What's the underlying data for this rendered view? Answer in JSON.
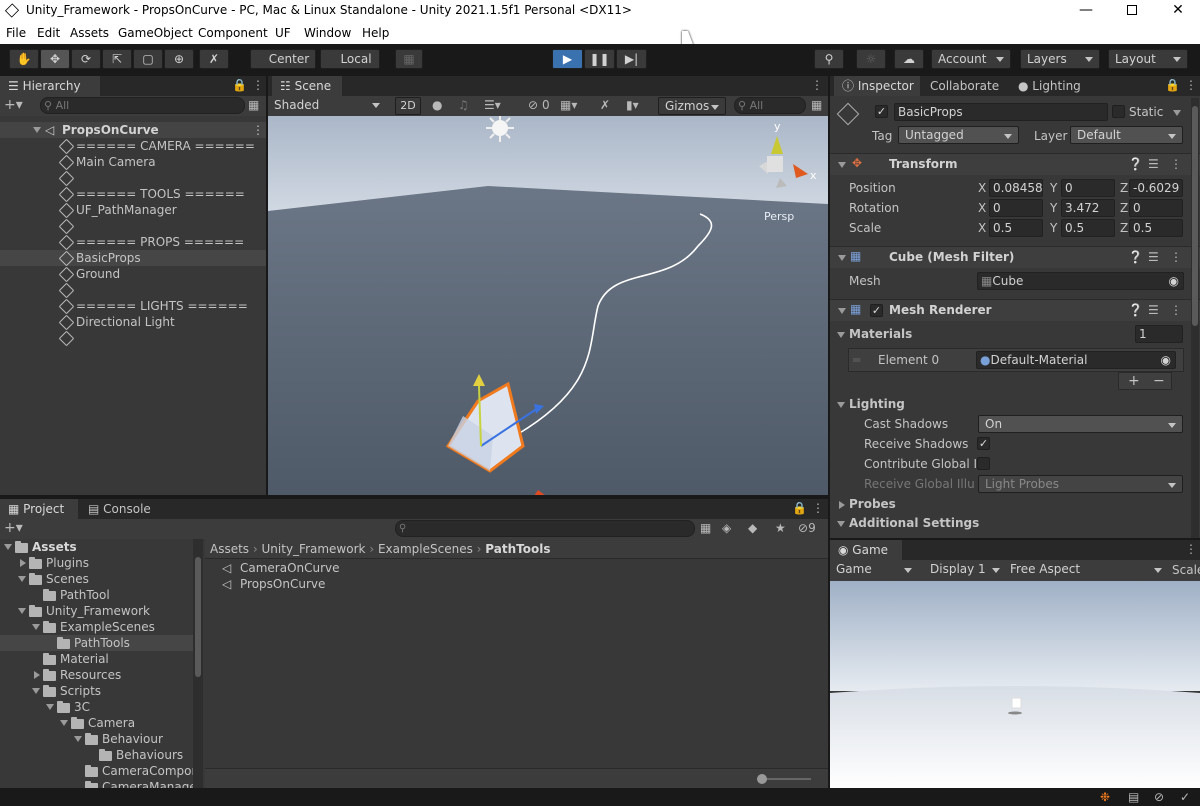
{
  "window": {
    "title": "Unity_Framework - PropsOnCurve - PC, Mac & Linux Standalone - Unity 2021.1.5f1 Personal <DX11>"
  },
  "menu": [
    "File",
    "Edit",
    "Assets",
    "GameObject",
    "Component",
    "UF",
    "Window",
    "Help"
  ],
  "toolbar": {
    "center": "Center",
    "local": "Local",
    "account": "Account",
    "layers": "Layers",
    "layout": "Layout"
  },
  "hierarchy": {
    "tab": "Hierarchy",
    "search_placeholder": "All",
    "scene": "PropsOnCurve",
    "items": [
      "====== CAMERA ======",
      "Main Camera",
      "",
      "====== TOOLS ======",
      "UF_PathManager",
      "",
      "====== PROPS ======",
      "BasicProps",
      "Ground",
      "",
      "====== LIGHTS ======",
      "Directional Light",
      ""
    ]
  },
  "scene": {
    "tab": "Scene",
    "shading": "Shaded",
    "mode2d": "2D",
    "hidden_count": "0",
    "gizmos": "Gizmos",
    "search_placeholder": "All",
    "persp": "Persp",
    "axis_x": "x",
    "axis_y": "y"
  },
  "inspector": {
    "tabs": [
      "Inspector",
      "Collaborate",
      "Lighting"
    ],
    "object_name": "BasicProps",
    "static_label": "Static",
    "tag_label": "Tag",
    "tag": "Untagged",
    "layer_label": "Layer",
    "layer": "Default",
    "transform": {
      "title": "Transform",
      "position": {
        "label": "Position",
        "x": "0.08458",
        "y": "0",
        "z": "-0.6029"
      },
      "rotation": {
        "label": "Rotation",
        "x": "0",
        "y": "3.472",
        "z": "0"
      },
      "scale": {
        "label": "Scale",
        "x": "0.5",
        "y": "0.5",
        "z": "0.5"
      }
    },
    "mesh_filter": {
      "title": "Cube (Mesh Filter)",
      "mesh_label": "Mesh",
      "mesh": "Cube"
    },
    "mesh_renderer": {
      "title": "Mesh Renderer",
      "materials_label": "Materials",
      "materials_count": "1",
      "element_label": "Element 0",
      "element_value": "Default-Material",
      "lighting_label": "Lighting",
      "cast_shadows_label": "Cast Shadows",
      "cast_shadows": "On",
      "receive_shadows_label": "Receive Shadows",
      "contribute_label": "Contribute Global Ill",
      "receive_gi_label": "Receive Global Illum",
      "receive_gi": "Light Probes",
      "probes_label": "Probes",
      "additional_label": "Additional Settings"
    }
  },
  "project": {
    "tabs": [
      "Project",
      "Console"
    ],
    "hidden_count": "9",
    "tree": [
      {
        "label": "Assets",
        "indent": 0,
        "arrow": "down",
        "bold": true
      },
      {
        "label": "Plugins",
        "indent": 1,
        "arrow": "right"
      },
      {
        "label": "Scenes",
        "indent": 1,
        "arrow": "down"
      },
      {
        "label": "PathTool",
        "indent": 2,
        "arrow": ""
      },
      {
        "label": "Unity_Framework",
        "indent": 1,
        "arrow": "down"
      },
      {
        "label": "ExampleScenes",
        "indent": 2,
        "arrow": "down"
      },
      {
        "label": "PathTools",
        "indent": 3,
        "arrow": "",
        "selected": true
      },
      {
        "label": "Material",
        "indent": 2,
        "arrow": ""
      },
      {
        "label": "Resources",
        "indent": 2,
        "arrow": "right"
      },
      {
        "label": "Scripts",
        "indent": 2,
        "arrow": "down"
      },
      {
        "label": "3C",
        "indent": 3,
        "arrow": "down"
      },
      {
        "label": "Camera",
        "indent": 4,
        "arrow": "down"
      },
      {
        "label": "Behaviour",
        "indent": 5,
        "arrow": "down"
      },
      {
        "label": "Behaviours",
        "indent": 6,
        "arrow": ""
      },
      {
        "label": "CameraCompor",
        "indent": 5,
        "arrow": ""
      },
      {
        "label": "CameraManage",
        "indent": 5,
        "arrow": ""
      }
    ],
    "breadcrumb": [
      "Assets",
      "Unity_Framework",
      "ExampleScenes",
      "PathTools"
    ],
    "files": [
      "CameraOnCurve",
      "PropsOnCurve"
    ]
  },
  "game": {
    "tab": "Game",
    "mode": "Game",
    "display": "Display 1",
    "aspect": "Free Aspect",
    "scale": "Scale"
  },
  "colors": {
    "accent_blue": "#3a72b0",
    "selection": "#2c5d87",
    "selection_gray": "#464646",
    "orange": "#f07a1d"
  }
}
